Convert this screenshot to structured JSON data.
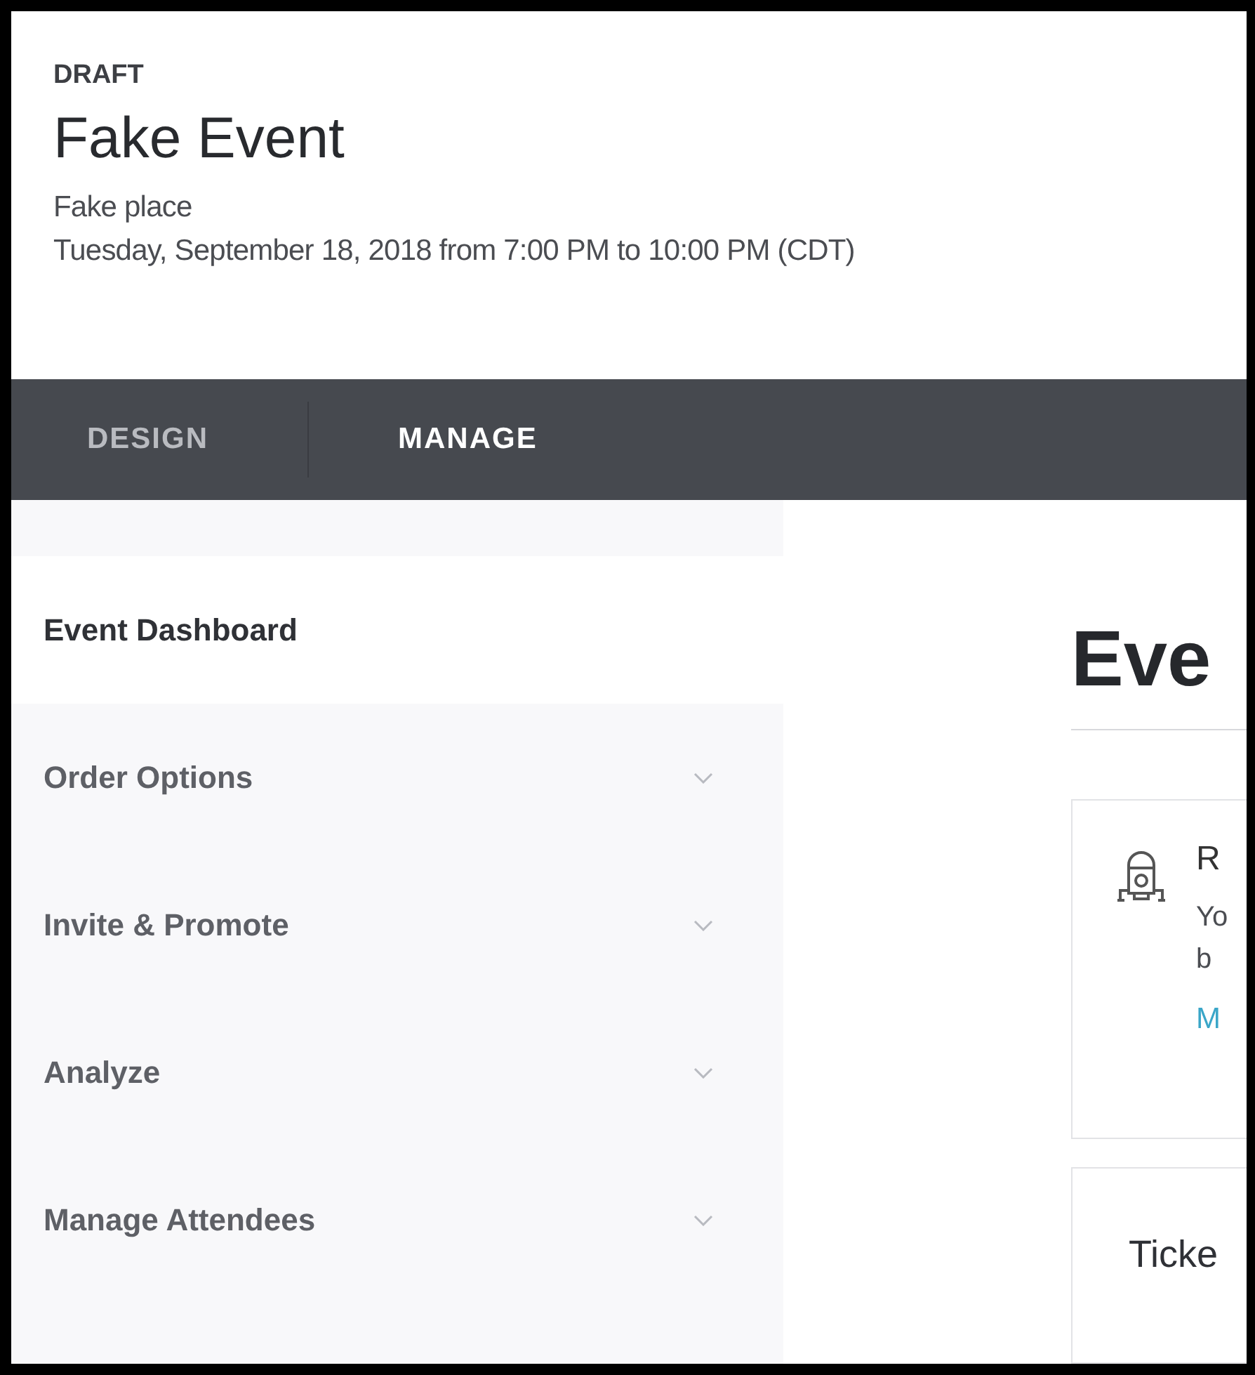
{
  "event": {
    "status": "DRAFT",
    "title": "Fake Event",
    "place": "Fake place",
    "datetime": "Tuesday, September 18, 2018 from 7:00 PM to 10:00 PM (CDT)"
  },
  "tabs": [
    {
      "label": "DESIGN",
      "selected": false
    },
    {
      "label": "MANAGE",
      "selected": true
    }
  ],
  "sidebar": {
    "items": [
      {
        "label": "Event Dashboard",
        "selected": true,
        "expandable": false
      },
      {
        "label": "Order Options",
        "selected": false,
        "expandable": true
      },
      {
        "label": "Invite & Promote",
        "selected": false,
        "expandable": true
      },
      {
        "label": "Analyze",
        "selected": false,
        "expandable": true
      },
      {
        "label": "Manage Attendees",
        "selected": false,
        "expandable": true
      }
    ]
  },
  "main": {
    "heading": "Eve",
    "cards": [
      {
        "kind": "notice",
        "title": "R",
        "lines": [
          "Yo",
          "b"
        ],
        "link": "M"
      },
      {
        "kind": "tickets",
        "title": "Ticke"
      }
    ]
  }
}
